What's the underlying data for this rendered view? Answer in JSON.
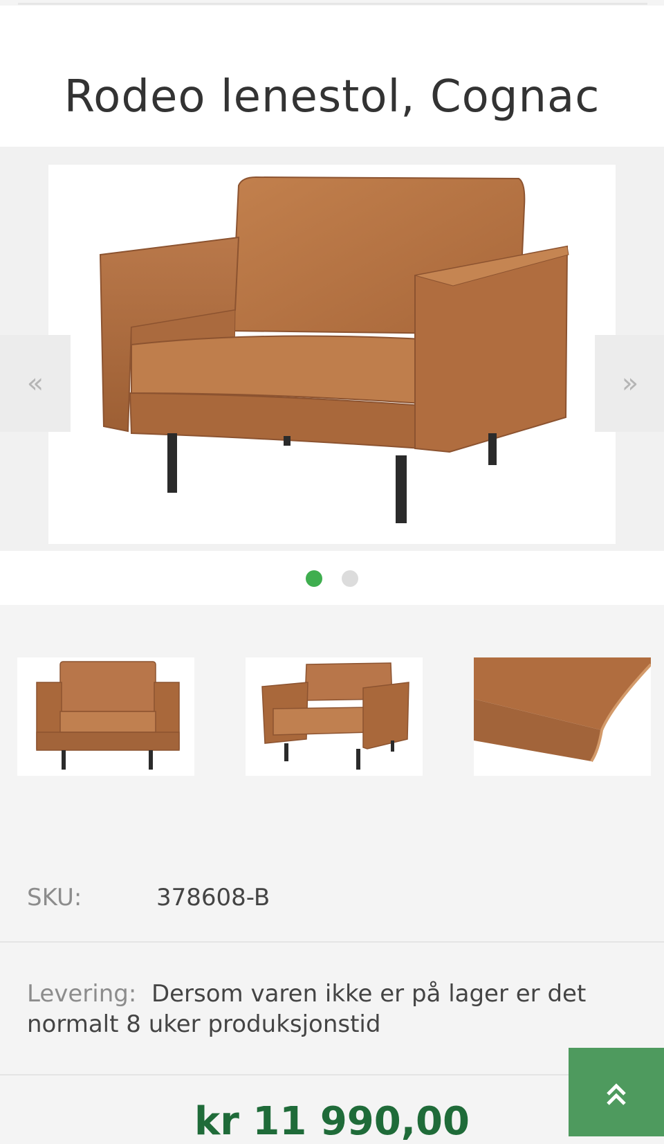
{
  "product": {
    "title": "Rodeo lenestol, Cognac",
    "sku_label": "SKU:",
    "sku_value": "378608-B",
    "delivery_label": "Levering:",
    "delivery_text": "Dersom varen ikke er på lager er det normalt 8 uker produksjonstid",
    "price": "kr 11 990,00"
  },
  "gallery": {
    "prev_glyph": "«",
    "next_glyph": "»",
    "slide_count": 2,
    "active_slide": 1,
    "thumbnails": [
      "chair-front-thumbnail",
      "chair-angle-thumbnail",
      "cushion-detail-thumbnail"
    ]
  },
  "scroll_to_top_glyph": "⌃",
  "colors": {
    "accent_green": "#3fae4f",
    "price_green": "#1f6b39",
    "button_green": "#4e9a5e",
    "leather": "#b4713f"
  }
}
